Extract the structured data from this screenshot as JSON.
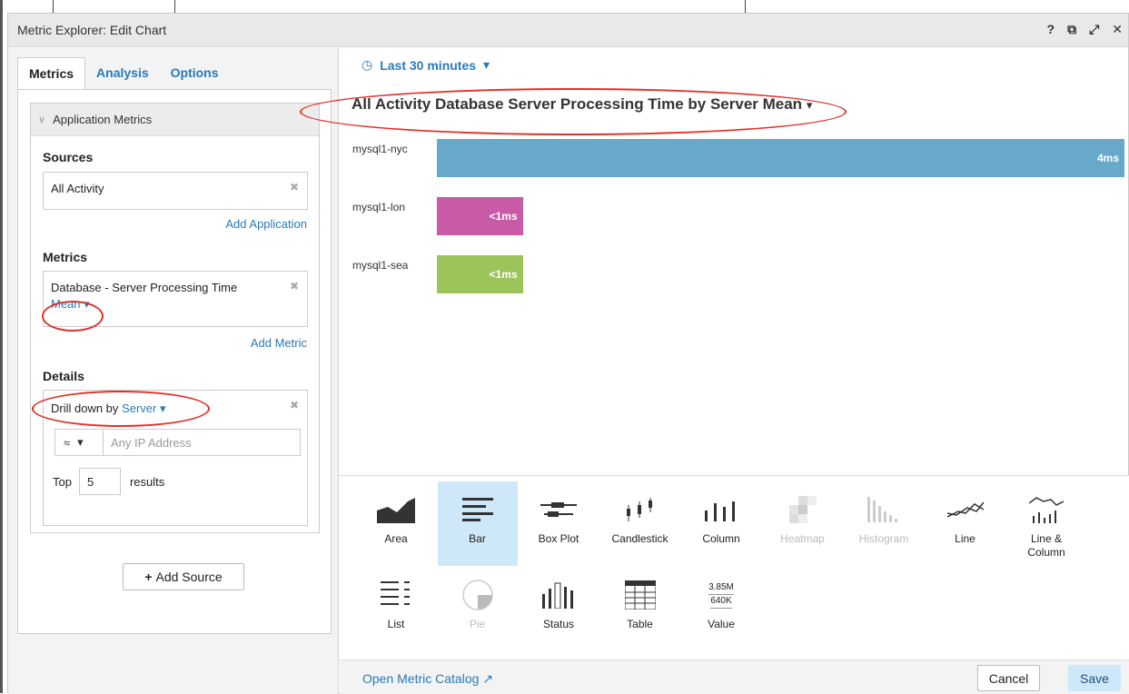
{
  "window": {
    "title": "Metric Explorer: Edit Chart",
    "controls": [
      "?",
      "⧉",
      "⤢",
      "✕"
    ]
  },
  "left": {
    "tabs": [
      {
        "label": "Metrics",
        "active": true
      },
      {
        "label": "Analysis",
        "active": false
      },
      {
        "label": "Options",
        "active": false
      }
    ],
    "section_title": "Application Metrics",
    "sources_label": "Sources",
    "source_value": "All Activity",
    "add_application": "Add Application",
    "metrics_label": "Metrics",
    "metric_value": "Database - Server Processing Time",
    "metric_stat": "Mean",
    "add_metric": "Add Metric",
    "details_label": "Details",
    "drilldown_prefix": "Drill down by",
    "drilldown_value": "Server",
    "ip_operator": "≈",
    "ip_placeholder": "Any IP Address",
    "top_label": "Top",
    "top_value": "5",
    "results_label": "results",
    "add_source": "Add Source"
  },
  "time_range": "Last 30 minutes",
  "chart_title": "All Activity Database Server Processing Time by Server Mean",
  "chart_data": {
    "type": "bar",
    "categories": [
      "mysql1-nyc",
      "mysql1-lon",
      "mysql1-sea"
    ],
    "values": [
      4,
      0.5,
      0.5
    ],
    "data_labels": [
      "4ms",
      "<1ms",
      "<1ms"
    ],
    "colors": [
      "#68a8c9",
      "#c95aa6",
      "#9dc45a"
    ],
    "xlim": [
      0,
      4
    ],
    "unit": "ms"
  },
  "chart_types": [
    {
      "label": "Area",
      "icon": "area-chart-icon",
      "selected": false,
      "disabled": false
    },
    {
      "label": "Bar",
      "icon": "bar-chart-icon",
      "selected": true,
      "disabled": false
    },
    {
      "label": "Box Plot",
      "icon": "box-plot-icon",
      "selected": false,
      "disabled": false
    },
    {
      "label": "Candlestick",
      "icon": "candlestick-icon",
      "selected": false,
      "disabled": false
    },
    {
      "label": "Column",
      "icon": "column-chart-icon",
      "selected": false,
      "disabled": false
    },
    {
      "label": "Heatmap",
      "icon": "heatmap-icon",
      "selected": false,
      "disabled": true
    },
    {
      "label": "Histogram",
      "icon": "histogram-icon",
      "selected": false,
      "disabled": true
    },
    {
      "label": "Line",
      "icon": "line-chart-icon",
      "selected": false,
      "disabled": false
    },
    {
      "label": "Line & Column",
      "icon": "line-column-icon",
      "selected": false,
      "disabled": false
    },
    {
      "label": "List",
      "icon": "list-icon",
      "selected": false,
      "disabled": false
    },
    {
      "label": "Pie",
      "icon": "pie-chart-icon",
      "selected": false,
      "disabled": true
    },
    {
      "label": "Status",
      "icon": "status-icon",
      "selected": false,
      "disabled": false
    },
    {
      "label": "Table",
      "icon": "table-icon",
      "selected": false,
      "disabled": false
    },
    {
      "label": "Value",
      "icon": "value-icon",
      "selected": false,
      "disabled": false,
      "sample_lines": [
        "3.85M",
        "640K"
      ]
    }
  ],
  "footer": {
    "catalog_link": "Open Metric Catalog",
    "cancel": "Cancel",
    "save": "Save"
  },
  "colors": {
    "accent": "#2a7ab8",
    "annotation": "#e0322a",
    "selected_bg": "#cfe8f9"
  }
}
